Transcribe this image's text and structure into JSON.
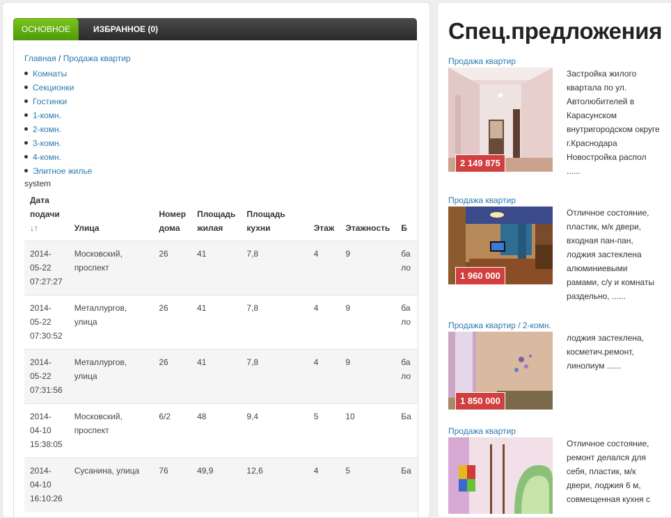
{
  "tabs": {
    "main": "Основное",
    "favorites": "Избранное (0)"
  },
  "breadcrumb": {
    "home": "Главная",
    "sep": "/",
    "current": "Продажа квартир"
  },
  "categories": [
    "Комнаты",
    "Секционки",
    "Гостинки",
    "1-комн.",
    "2-комн.",
    "3-комн.",
    "4-комн.",
    "Элитное жилье"
  ],
  "system_text": "system",
  "table": {
    "headers": {
      "date": "Дата подачи",
      "sort_arrows": "↓↑",
      "street": "Улица",
      "house": "Номер дома",
      "living_area": "Площадь жилая",
      "kitchen_area": "Площадь кухни",
      "floor": "Этаж",
      "floors": "Этажность",
      "extra": "Б"
    },
    "rows": [
      {
        "date": "2014-05-22 07:27:27",
        "street": "Московский, проспект",
        "house": "26",
        "living": "41",
        "kitchen": "7,8",
        "floor": "4",
        "floors": "9",
        "extra": "ба ло"
      },
      {
        "date": "2014-05-22 07:30:52",
        "street": "Металлургов, улица",
        "house": "26",
        "living": "41",
        "kitchen": "7,8",
        "floor": "4",
        "floors": "9",
        "extra": "ба ло"
      },
      {
        "date": "2014-05-22 07:31:56",
        "street": "Металлургов, улица",
        "house": "26",
        "living": "41",
        "kitchen": "7,8",
        "floor": "4",
        "floors": "9",
        "extra": "ба ло"
      },
      {
        "date": "2014-04-10 15:38:05",
        "street": "Московский, проспект",
        "house": "6/2",
        "living": "48",
        "kitchen": "9,4",
        "floor": "5",
        "floors": "10",
        "extra": "Ба"
      },
      {
        "date": "2014-04-10 16:10:26",
        "street": "Сусанина, улица",
        "house": "76",
        "living": "49,9",
        "kitchen": "12,6",
        "floor": "4",
        "floors": "5",
        "extra": "Ба"
      }
    ]
  },
  "sidebar": {
    "title": "Спец.предложения",
    "offers": [
      {
        "category": "Продажа квартир",
        "price": "2 149 875",
        "description": "Застройка жилого квартала по ул. Автолюбителей в Карасунском внутригородском округе г.Краснодара Новостройка распол ......"
      },
      {
        "category": "Продажа квартир",
        "price": "1 960 000",
        "description": "Отличное состояние, пластик, м/к двери, входная пан-пан, лоджия застеклена алюминиевыми рамами, с/у и комнаты раздельно, ......"
      },
      {
        "category": "Продажа квартир / 2-комн.",
        "price": "1 850 000",
        "description": "лоджия застеклена, косметич.ремонт, линолиум ......"
      },
      {
        "category": "Продажа квартир",
        "price": "",
        "description": "Отличное состояние, ремонт делался для себя, пластик, м/к двери, лоджия 6 м, совмещенная кухня с"
      }
    ]
  }
}
